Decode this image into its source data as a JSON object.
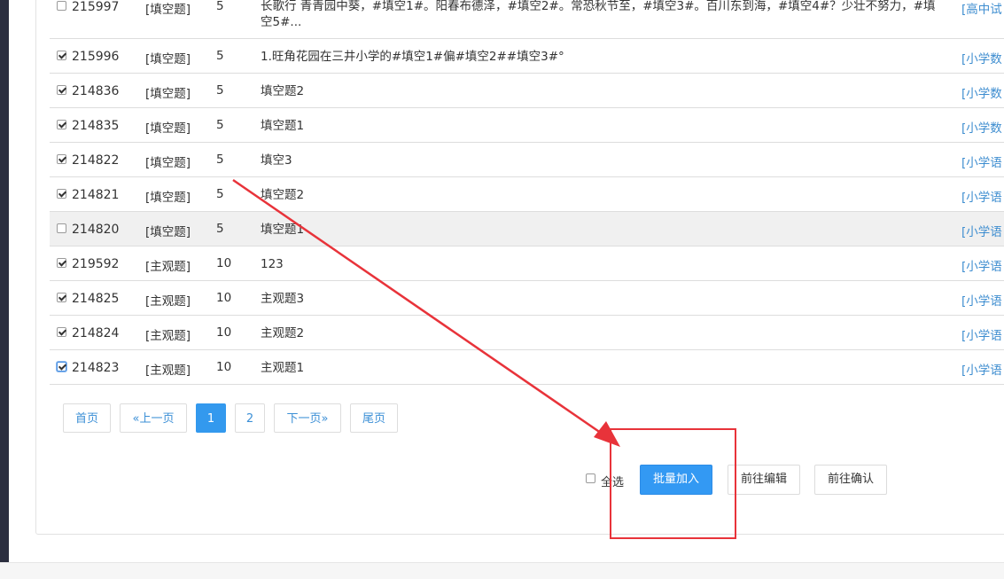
{
  "rows": [
    {
      "checked": false,
      "id": "215997",
      "type": "[填空题]",
      "score": "5",
      "title": "长歌行 青青园中葵，#填空1#。阳春布德泽，#填空2#。常恐秋节至，#填空3#。百川东到海，#填空4#？少壮不努力，#填空5#...",
      "category": "[高中试"
    },
    {
      "checked": true,
      "id": "215996",
      "type": "[填空题]",
      "score": "5",
      "title": "1.旺角花园在三井小学的#填空1#偏#填空2##填空3#°",
      "category": "[小学数"
    },
    {
      "checked": true,
      "id": "214836",
      "type": "[填空题]",
      "score": "5",
      "title": "填空题2",
      "category": "[小学数"
    },
    {
      "checked": true,
      "id": "214835",
      "type": "[填空题]",
      "score": "5",
      "title": "填空题1",
      "category": "[小学数"
    },
    {
      "checked": true,
      "id": "214822",
      "type": "[填空题]",
      "score": "5",
      "title": "填空3",
      "category": "[小学语"
    },
    {
      "checked": true,
      "id": "214821",
      "type": "[填空题]",
      "score": "5",
      "title": "填空题2",
      "category": "[小学语"
    },
    {
      "checked": false,
      "id": "214820",
      "type": "[填空题]",
      "score": "5",
      "title": "填空题1",
      "category": "[小学语",
      "highlighted": true
    },
    {
      "checked": true,
      "id": "219592",
      "type": "[主观题]",
      "score": "10",
      "title": "123",
      "category": "[小学语"
    },
    {
      "checked": true,
      "id": "214825",
      "type": "[主观题]",
      "score": "10",
      "title": "主观题3",
      "category": "[小学语"
    },
    {
      "checked": true,
      "id": "214824",
      "type": "[主观题]",
      "score": "10",
      "title": "主观题2",
      "category": "[小学语"
    },
    {
      "checked": true,
      "id": "214823",
      "type": "[主观题]",
      "score": "10",
      "title": "主观题1",
      "category": "[小学语",
      "focused": true
    }
  ],
  "pagination": {
    "first": "首页",
    "prev": "«上一页",
    "page1": "1",
    "page2": "2",
    "next": "下一页»",
    "last": "尾页",
    "current": 1
  },
  "actions": {
    "select_all": "全选",
    "batch_add": "批量加入",
    "go_edit": "前往编辑",
    "go_confirm": "前往确认"
  },
  "colors": {
    "link": "#3b8fd6",
    "primary": "#3399f3",
    "annotation": "#e8333a"
  }
}
